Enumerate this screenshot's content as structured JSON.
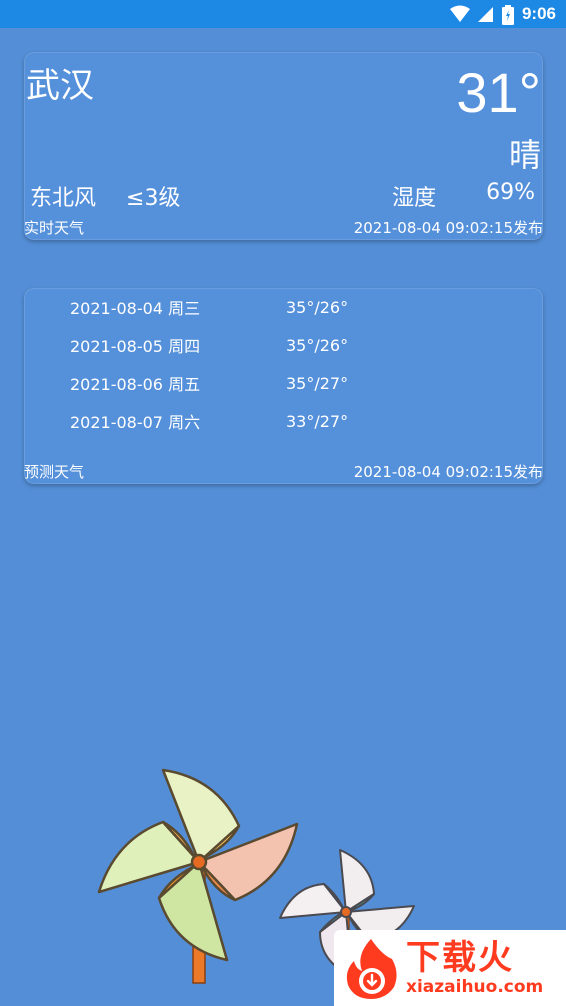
{
  "status_bar": {
    "time": "9:06"
  },
  "current": {
    "city": "武汉",
    "temperature": "31°",
    "condition": "晴",
    "wind_direction": "东北风",
    "wind_level": "≤3级",
    "humidity_label": "湿度",
    "humidity_value": "69%",
    "footer_label": "实时天气",
    "published": "2021-08-04 09:02:15发布"
  },
  "forecast": {
    "rows": [
      {
        "date": "2021-08-04  周三",
        "range": "35°/26°"
      },
      {
        "date": "2021-08-05  周四",
        "range": "35°/26°"
      },
      {
        "date": "2021-08-06  周五",
        "range": "35°/27°"
      },
      {
        "date": "2021-08-07  周六",
        "range": "33°/27°"
      }
    ],
    "footer_label": "预测天气",
    "published": "2021-08-04 09:02:15发布"
  },
  "watermark": {
    "title": "下载火",
    "url": "xiazaihuo.com"
  },
  "colors": {
    "background": "#548ed6",
    "status_bar": "#1e88e5",
    "watermark_red": "#ff3b1f"
  },
  "icons": [
    "wifi-icon",
    "signal-icon",
    "battery-icon",
    "pinwheel-large",
    "pinwheel-small",
    "fire-logo-icon"
  ]
}
